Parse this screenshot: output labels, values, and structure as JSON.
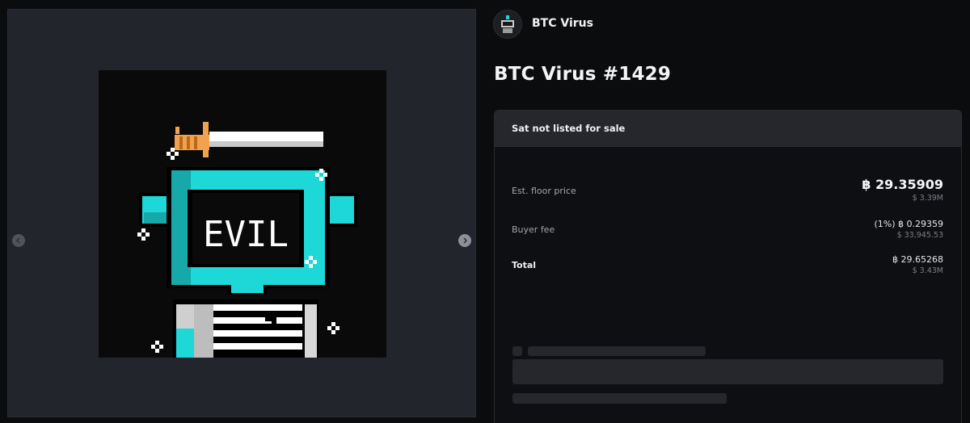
{
  "collection": {
    "name": "BTC Virus"
  },
  "item": {
    "title": "BTC Virus #1429",
    "art_text": "EVIL"
  },
  "viewer": {
    "prev_icon": "chevron-left-icon",
    "next_icon": "chevron-right-icon"
  },
  "sale": {
    "status": "Sat not listed for sale",
    "rows": [
      {
        "label": "Est. floor price",
        "main": "฿ 29.35909",
        "sub": "$ 3.39M"
      },
      {
        "label": "Buyer fee",
        "main": "(1%) ฿ 0.29359",
        "sub": "$ 33,945.53"
      },
      {
        "label": "Total",
        "main": "฿ 29.65268",
        "sub": "$ 3.43M"
      }
    ]
  },
  "colors": {
    "background": "#0b0c0e",
    "panel_header": "#25272d",
    "art_cyan": "#1ed7d7",
    "sword_handle": "#f2a24d"
  }
}
